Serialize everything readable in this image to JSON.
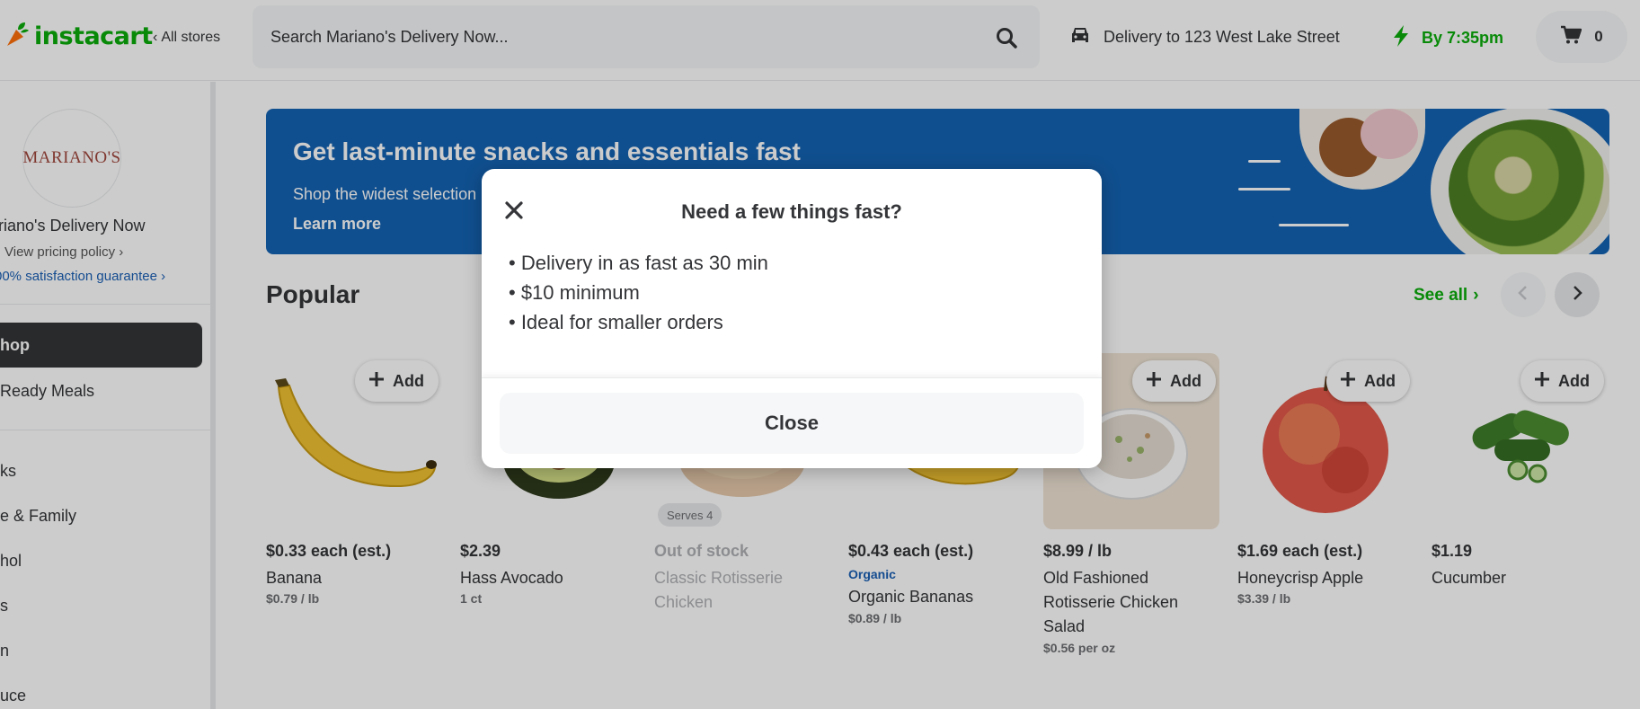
{
  "header": {
    "logo_text": "instacart",
    "all_stores": "All stores",
    "search_placeholder": "Search Mariano's Delivery Now...",
    "delivery_text": "Delivery to 123 West Lake Street",
    "eta_text": "By 7:35pm",
    "cart_count": "0",
    "brand_color": "#0aad0a"
  },
  "sidebar": {
    "store_logo_text": "MARIANO'S",
    "store_name": "ariano's Delivery Now",
    "pricing_link": "View pricing policy",
    "guarantee_link": "00% satisfaction guarantee",
    "nav_shop": "hop",
    "nav_ready_meals": "Ready Meals",
    "nav_items": [
      "ks",
      "e & Family",
      "hol",
      "s",
      "n",
      "uce"
    ]
  },
  "banner": {
    "title": "Get last-minute snacks and essentials fast",
    "subtitle": "Shop the widest selection",
    "link": "Learn more",
    "bg_color": "#1463b3"
  },
  "popular": {
    "title": "Popular",
    "see_all": "See all",
    "add_label": "Add",
    "products": [
      {
        "price": "$0.33 each (est.)",
        "name": "Banana",
        "sub": "$0.79 / lb"
      },
      {
        "price": "$2.39",
        "name": "Hass Avocado",
        "sub": "1 ct"
      },
      {
        "price": "Out of stock",
        "name": "Classic Rotisserie Chicken",
        "badge": "Serves 4"
      },
      {
        "price": "$0.43 each (est.)",
        "tag": "Organic",
        "name": "Organic Bananas",
        "sub": "$0.89 / lb"
      },
      {
        "price": "$8.99 / lb",
        "name": "Old Fashioned Rotisserie Chicken Salad",
        "sub": "$0.56 per oz"
      },
      {
        "price": "$1.69 each (est.)",
        "name": "Honeycrisp Apple",
        "sub": "$3.39 / lb"
      },
      {
        "price": "$1.19",
        "name": "Cucumber"
      }
    ]
  },
  "modal": {
    "title": "Need a few things fast?",
    "bullets": [
      "• Delivery in as fast as 30 min",
      "• $10 minimum",
      "• Ideal for smaller orders"
    ],
    "close_button": "Close"
  },
  "icons": {
    "logo": "carrot-icon",
    "search": "search-icon",
    "delivery": "car-icon",
    "eta": "lightning-icon",
    "cart": "cart-icon",
    "close": "close-icon"
  }
}
